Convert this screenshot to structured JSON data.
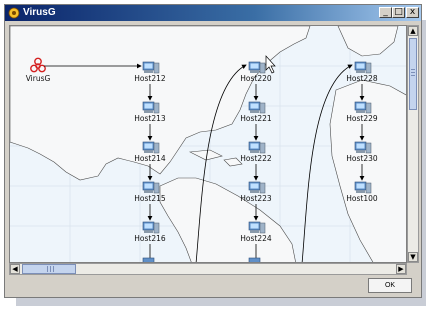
{
  "window": {
    "title": "VirusG",
    "controls": {
      "minimize": "_",
      "maximize": "□",
      "close": "x"
    }
  },
  "graph": {
    "virus_label": "VirusG",
    "columns": [
      {
        "hosts": [
          "Host212",
          "Host213",
          "Host214",
          "Host215",
          "Host216"
        ]
      },
      {
        "hosts": [
          "Host220",
          "Host221",
          "Host222",
          "Host223",
          "Host224"
        ]
      },
      {
        "hosts": [
          "Host228",
          "Host229",
          "Host230",
          "Host100"
        ]
      }
    ]
  },
  "buttons": {
    "ok": "OK"
  },
  "icons": {
    "virus": "biohazard-icon",
    "host": "computer-icon",
    "cursor": "mouse-cursor-icon"
  },
  "colors": {
    "title_bar": "#0a246a",
    "map_water": "#eef5fb",
    "virus_red": "#d42020",
    "edge": "#000000"
  }
}
